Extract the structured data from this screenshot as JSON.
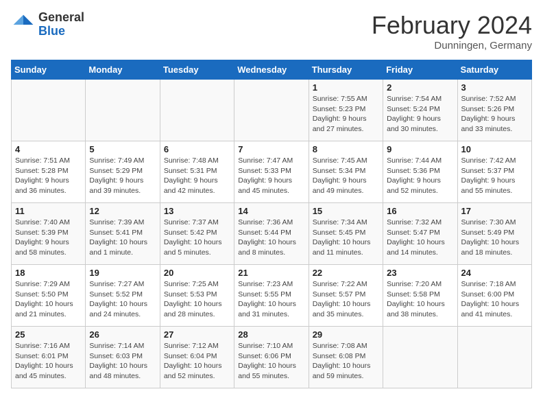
{
  "header": {
    "logo_general": "General",
    "logo_blue": "Blue",
    "title": "February 2024",
    "subtitle": "Dunningen, Germany"
  },
  "days_of_week": [
    "Sunday",
    "Monday",
    "Tuesday",
    "Wednesday",
    "Thursday",
    "Friday",
    "Saturday"
  ],
  "weeks": [
    [
      {
        "day": "",
        "info": ""
      },
      {
        "day": "",
        "info": ""
      },
      {
        "day": "",
        "info": ""
      },
      {
        "day": "",
        "info": ""
      },
      {
        "day": "1",
        "info": "Sunrise: 7:55 AM\nSunset: 5:23 PM\nDaylight: 9 hours and 27 minutes."
      },
      {
        "day": "2",
        "info": "Sunrise: 7:54 AM\nSunset: 5:24 PM\nDaylight: 9 hours and 30 minutes."
      },
      {
        "day": "3",
        "info": "Sunrise: 7:52 AM\nSunset: 5:26 PM\nDaylight: 9 hours and 33 minutes."
      }
    ],
    [
      {
        "day": "4",
        "info": "Sunrise: 7:51 AM\nSunset: 5:28 PM\nDaylight: 9 hours and 36 minutes."
      },
      {
        "day": "5",
        "info": "Sunrise: 7:49 AM\nSunset: 5:29 PM\nDaylight: 9 hours and 39 minutes."
      },
      {
        "day": "6",
        "info": "Sunrise: 7:48 AM\nSunset: 5:31 PM\nDaylight: 9 hours and 42 minutes."
      },
      {
        "day": "7",
        "info": "Sunrise: 7:47 AM\nSunset: 5:33 PM\nDaylight: 9 hours and 45 minutes."
      },
      {
        "day": "8",
        "info": "Sunrise: 7:45 AM\nSunset: 5:34 PM\nDaylight: 9 hours and 49 minutes."
      },
      {
        "day": "9",
        "info": "Sunrise: 7:44 AM\nSunset: 5:36 PM\nDaylight: 9 hours and 52 minutes."
      },
      {
        "day": "10",
        "info": "Sunrise: 7:42 AM\nSunset: 5:37 PM\nDaylight: 9 hours and 55 minutes."
      }
    ],
    [
      {
        "day": "11",
        "info": "Sunrise: 7:40 AM\nSunset: 5:39 PM\nDaylight: 9 hours and 58 minutes."
      },
      {
        "day": "12",
        "info": "Sunrise: 7:39 AM\nSunset: 5:41 PM\nDaylight: 10 hours and 1 minute."
      },
      {
        "day": "13",
        "info": "Sunrise: 7:37 AM\nSunset: 5:42 PM\nDaylight: 10 hours and 5 minutes."
      },
      {
        "day": "14",
        "info": "Sunrise: 7:36 AM\nSunset: 5:44 PM\nDaylight: 10 hours and 8 minutes."
      },
      {
        "day": "15",
        "info": "Sunrise: 7:34 AM\nSunset: 5:45 PM\nDaylight: 10 hours and 11 minutes."
      },
      {
        "day": "16",
        "info": "Sunrise: 7:32 AM\nSunset: 5:47 PM\nDaylight: 10 hours and 14 minutes."
      },
      {
        "day": "17",
        "info": "Sunrise: 7:30 AM\nSunset: 5:49 PM\nDaylight: 10 hours and 18 minutes."
      }
    ],
    [
      {
        "day": "18",
        "info": "Sunrise: 7:29 AM\nSunset: 5:50 PM\nDaylight: 10 hours and 21 minutes."
      },
      {
        "day": "19",
        "info": "Sunrise: 7:27 AM\nSunset: 5:52 PM\nDaylight: 10 hours and 24 minutes."
      },
      {
        "day": "20",
        "info": "Sunrise: 7:25 AM\nSunset: 5:53 PM\nDaylight: 10 hours and 28 minutes."
      },
      {
        "day": "21",
        "info": "Sunrise: 7:23 AM\nSunset: 5:55 PM\nDaylight: 10 hours and 31 minutes."
      },
      {
        "day": "22",
        "info": "Sunrise: 7:22 AM\nSunset: 5:57 PM\nDaylight: 10 hours and 35 minutes."
      },
      {
        "day": "23",
        "info": "Sunrise: 7:20 AM\nSunset: 5:58 PM\nDaylight: 10 hours and 38 minutes."
      },
      {
        "day": "24",
        "info": "Sunrise: 7:18 AM\nSunset: 6:00 PM\nDaylight: 10 hours and 41 minutes."
      }
    ],
    [
      {
        "day": "25",
        "info": "Sunrise: 7:16 AM\nSunset: 6:01 PM\nDaylight: 10 hours and 45 minutes."
      },
      {
        "day": "26",
        "info": "Sunrise: 7:14 AM\nSunset: 6:03 PM\nDaylight: 10 hours and 48 minutes."
      },
      {
        "day": "27",
        "info": "Sunrise: 7:12 AM\nSunset: 6:04 PM\nDaylight: 10 hours and 52 minutes."
      },
      {
        "day": "28",
        "info": "Sunrise: 7:10 AM\nSunset: 6:06 PM\nDaylight: 10 hours and 55 minutes."
      },
      {
        "day": "29",
        "info": "Sunrise: 7:08 AM\nSunset: 6:08 PM\nDaylight: 10 hours and 59 minutes."
      },
      {
        "day": "",
        "info": ""
      },
      {
        "day": "",
        "info": ""
      }
    ]
  ]
}
